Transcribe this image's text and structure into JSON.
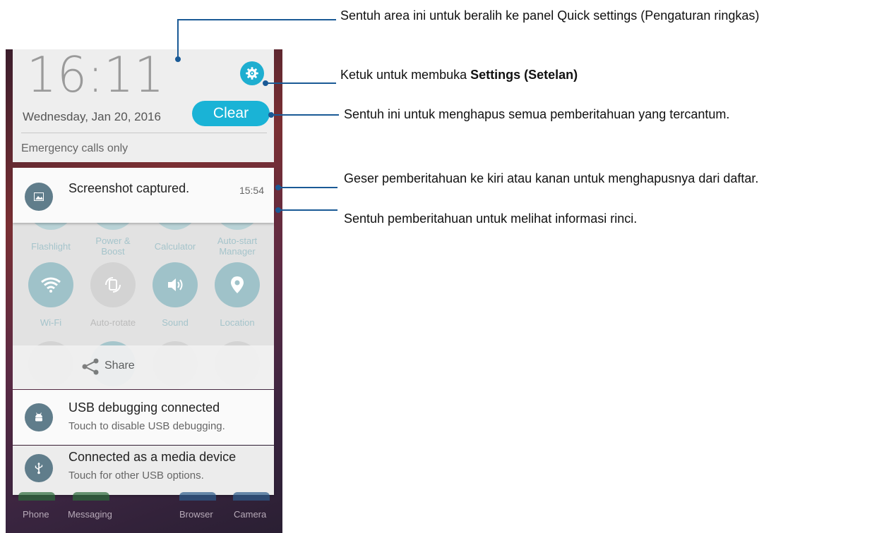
{
  "header": {
    "time": "16:11",
    "date": "Wednesday, Jan 20, 2016",
    "clear_label": "Clear",
    "network_status": "Emergency calls only"
  },
  "notifications": [
    {
      "title": "Screenshot captured.",
      "time": "15:54",
      "icon": "image-icon"
    },
    {
      "title": "USB debugging connected",
      "subtitle": "Touch to disable USB debugging.",
      "icon": "android-icon"
    },
    {
      "title": "Connected as a media device",
      "subtitle": "Touch for other USB options.",
      "icon": "usb-icon"
    }
  ],
  "quick_settings": {
    "row1": [
      "Flashlight",
      "Power &\nBoost",
      "Calculator",
      "Auto-start\nManager"
    ],
    "row2": [
      "Wi-Fi",
      "Auto-rotate",
      "Sound",
      "Location"
    ]
  },
  "share_label": "Share",
  "dock": [
    "Phone",
    "Messaging",
    "Browser",
    "Camera"
  ],
  "callouts": {
    "quick_settings": "Sentuh area ini untuk beralih ke panel Quick settings (Pengaturan ringkas)",
    "settings_prefix": "Ketuk untuk membuka ",
    "settings_bold": "Settings (Setelan)",
    "clear": "Sentuh ini untuk menghapus semua pemberitahuan yang tercantum.",
    "swipe": "Geser pemberitahuan ke kiri atau kanan untuk menghapusnya dari daftar.",
    "touch": "Sentuh pemberitahuan untuk melihat informasi rinci."
  },
  "colors": {
    "accent": "#1ab3d6",
    "callout_line": "#1a5a96",
    "notif_icon": "#607d8b"
  }
}
